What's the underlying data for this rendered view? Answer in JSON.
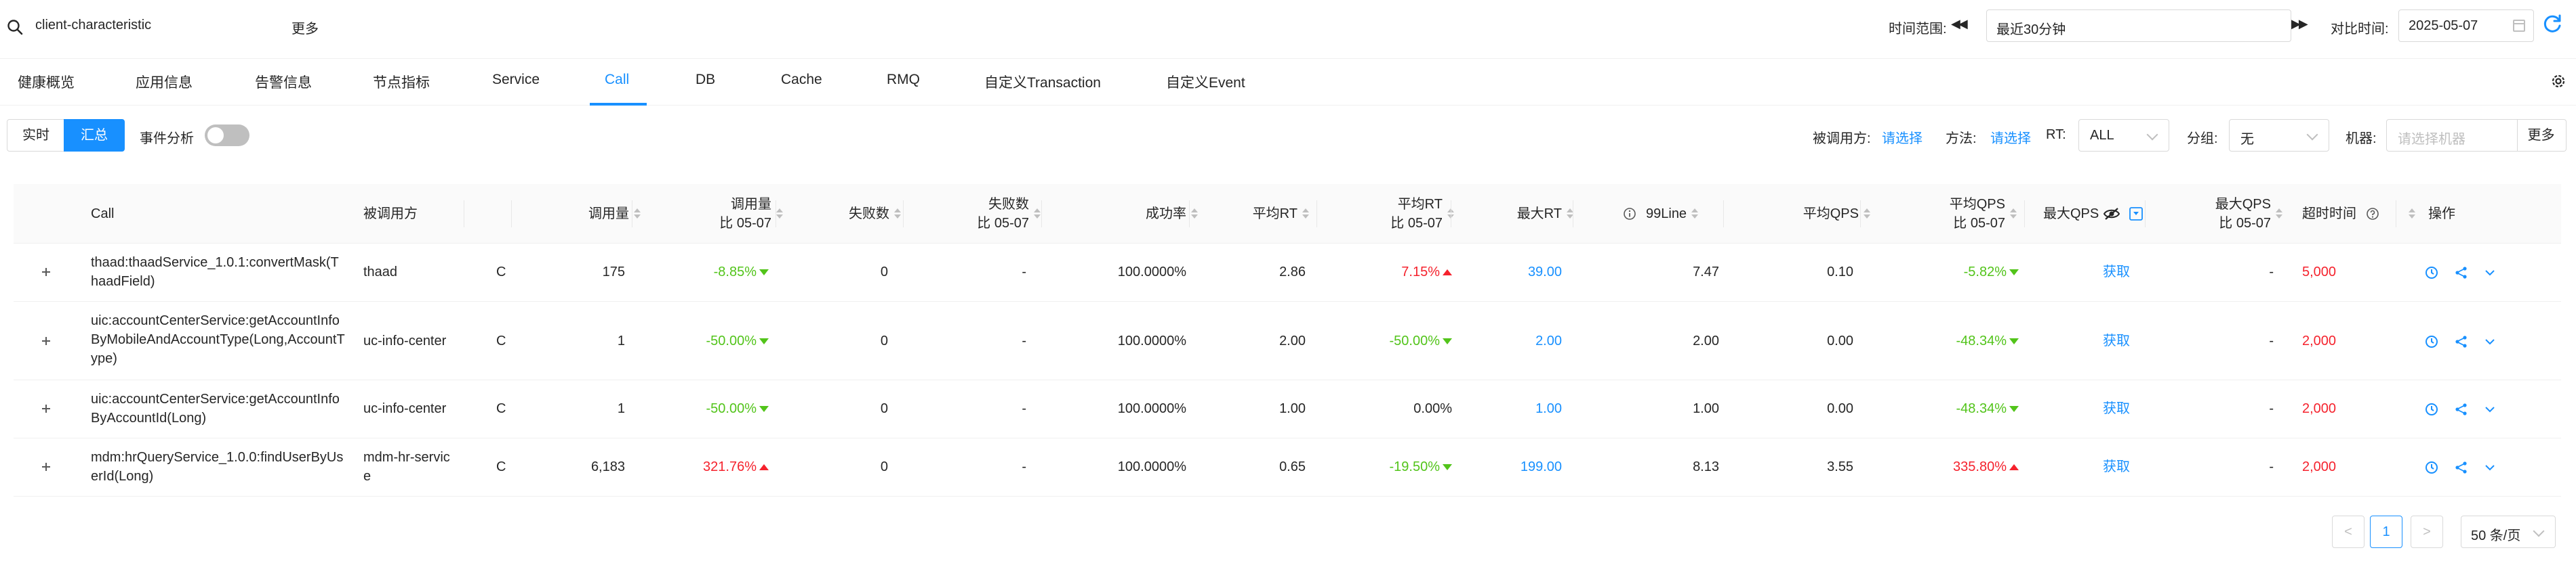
{
  "header": {
    "app_name": "client-characteristic",
    "more_label": "更多",
    "time_range_label": "时间范围:",
    "time_range_value": "最近30分钟",
    "compare_label": "对比时间:",
    "compare_value": "2025-05-07"
  },
  "tabs": [
    {
      "label": "健康概览"
    },
    {
      "label": "应用信息"
    },
    {
      "label": "告警信息"
    },
    {
      "label": "节点指标"
    },
    {
      "label": "Service"
    },
    {
      "label": "Call"
    },
    {
      "label": "DB"
    },
    {
      "label": "Cache"
    },
    {
      "label": "RMQ"
    },
    {
      "label": "自定义Transaction"
    },
    {
      "label": "自定义Event"
    }
  ],
  "active_tab": "Call",
  "filters": {
    "realtime_label": "实时",
    "summary_label": "汇总",
    "event_analysis_label": "事件分析",
    "callee_label": "被调用方:",
    "callee_placeholder": "请选择",
    "method_label": "方法:",
    "method_placeholder": "请选择",
    "rt_label": "RT:",
    "rt_value": "ALL",
    "group_label": "分组:",
    "group_value": "无",
    "machine_label": "机器:",
    "machine_placeholder": "请选择机器",
    "more_label": "更多"
  },
  "table": {
    "columns": {
      "call": "Call",
      "callee": "被调用方",
      "calls": "调用量",
      "calls_cmp_1": "调用量",
      "calls_cmp_2": "比 05-07",
      "fail": "失败数",
      "fail_cmp_1": "失败数",
      "fail_cmp_2": "比 05-07",
      "success_rate": "成功率",
      "avg_rt": "平均RT",
      "avg_rt_cmp_1": "平均RT",
      "avg_rt_cmp_2": "比 05-07",
      "max_rt": "最大RT",
      "line99": "99Line",
      "avg_qps": "平均QPS",
      "avg_qps_cmp_1": "平均QPS",
      "avg_qps_cmp_2": "比 05-07",
      "max_qps": "最大QPS",
      "max_qps_cmp_1": "最大QPS",
      "max_qps_cmp_2": "比 05-07",
      "timeout": "超时时间",
      "ops": "操作"
    },
    "rows": [
      {
        "call_1": "thaad:thaadService_1.0.1:convertMask(T",
        "call_2": "haadField)",
        "callee": "thaad",
        "type": "C",
        "calls": "175",
        "calls_cmp": "-8.85%",
        "fail": "0",
        "fail_cmp": "-",
        "success_rate": "100.0000%",
        "avg_rt": "2.86",
        "avg_rt_cmp": "7.15%",
        "max_rt": "39.00",
        "line99": "7.47",
        "avg_qps": "0.10",
        "avg_qps_cmp": "-5.82%",
        "max_qps": "获取",
        "max_qps_cmp": "-",
        "timeout": "5,000"
      },
      {
        "call_1": "uic:accountCenterService:getAccountInfo",
        "call_2": "ByMobileAndAccountType(Long,AccountT",
        "call_3": "ype)",
        "callee": "uc-info-center",
        "type": "C",
        "calls": "1",
        "calls_cmp": "-50.00%",
        "fail": "0",
        "fail_cmp": "-",
        "success_rate": "100.0000%",
        "avg_rt": "2.00",
        "avg_rt_cmp": "-50.00%",
        "max_rt": "2.00",
        "line99": "2.00",
        "avg_qps": "0.00",
        "avg_qps_cmp": "-48.34%",
        "max_qps": "获取",
        "max_qps_cmp": "-",
        "timeout": "2,000"
      },
      {
        "call_1": "uic:accountCenterService:getAccountInfo",
        "call_2": "ByAccountId(Long)",
        "callee": "uc-info-center",
        "type": "C",
        "calls": "1",
        "calls_cmp": "-50.00%",
        "fail": "0",
        "fail_cmp": "-",
        "success_rate": "100.0000%",
        "avg_rt": "1.00",
        "avg_rt_cmp": "0.00%",
        "max_rt": "1.00",
        "line99": "1.00",
        "avg_qps": "0.00",
        "avg_qps_cmp": "-48.34%",
        "max_qps": "获取",
        "max_qps_cmp": "-",
        "timeout": "2,000"
      },
      {
        "call_1": "mdm:hrQueryService_1.0.0:findUserByUs",
        "call_2": "erId(Long)",
        "callee_1": "mdm-hr-servic",
        "callee_2": "e",
        "type": "C",
        "calls": "6,183",
        "calls_cmp": "321.76%",
        "fail": "0",
        "fail_cmp": "-",
        "success_rate": "100.0000%",
        "avg_rt": "0.65",
        "avg_rt_cmp": "-19.50%",
        "max_rt": "199.00",
        "line99": "8.13",
        "avg_qps": "3.55",
        "avg_qps_cmp": "335.80%",
        "max_qps": "获取",
        "max_qps_cmp": "-",
        "timeout": "2,000"
      }
    ]
  },
  "pagination": {
    "prev": "<",
    "current_page": "1",
    "next": ">",
    "page_size": "50 条/页"
  },
  "colors": {
    "accent": "#1890ff",
    "positive": "#52c41a",
    "negative": "#f5222d"
  }
}
